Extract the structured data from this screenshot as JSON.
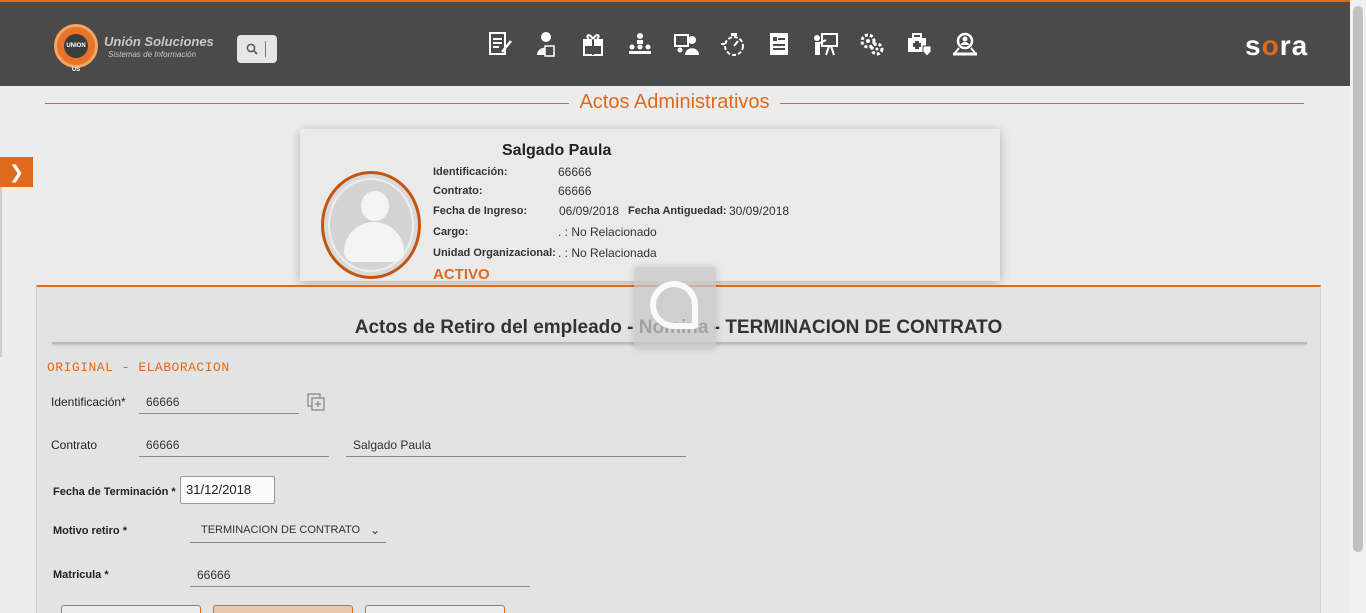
{
  "header": {
    "logo_mark": "UNION US",
    "logo_title": "Unión Soluciones",
    "logo_subtitle": "Sistemas de Información",
    "search_icon": "search-icon",
    "brand": {
      "s": "s",
      "o": "o",
      "ra": "ra"
    },
    "accent_color": "#e06a1c",
    "nav_icons": [
      "document-edit-icon",
      "person-doc-icon",
      "gift-icon",
      "org-chart-icon",
      "users-screen-icon",
      "stopwatch-icon",
      "report-list-icon",
      "presentation-icon",
      "gears-icon",
      "medical-kit-icon",
      "search-people-icon"
    ]
  },
  "section": {
    "title": "Actos Administrativos"
  },
  "sidebar_toggle": "❯",
  "employee": {
    "name": "Salgado Paula",
    "identificacion_label": "Identificación:",
    "identificacion": "66666",
    "contrato_label": "Contrato:",
    "contrato": "66666",
    "fecha_ingreso_label": "Fecha de Ingreso:",
    "fecha_ingreso": "06/09/2018",
    "fecha_antiguedad_label": "Fecha Antiguedad:",
    "fecha_antiguedad": "30/09/2018",
    "cargo_label": "Cargo:",
    "cargo": ". : No Relacionado",
    "unidad_label": "Unidad Organizacional:",
    "unidad": ". : No Relacionada",
    "estado": "ACTIVO"
  },
  "form": {
    "title": "Actos de Retiro del empleado - Nomina - TERMINACION DE CONTRATO",
    "stage": "ORIGINAL - ELABORACION",
    "identificacion_label": "Identificación*",
    "identificacion_value": "66666",
    "contrato_label": "Contrato",
    "contrato_value": "66666",
    "nombre_value": "Salgado Paula",
    "fecha_terminacion_label": "Fecha de Terminación",
    "fecha_terminacion_value": "31/12/2018",
    "motivo_label": "Motivo retiro",
    "motivo_value": "TERMINACION DE CONTRATO",
    "matricula_label": "Matricula",
    "matricula_value": "66666",
    "required_mark": "*",
    "chevron": "⌄"
  }
}
